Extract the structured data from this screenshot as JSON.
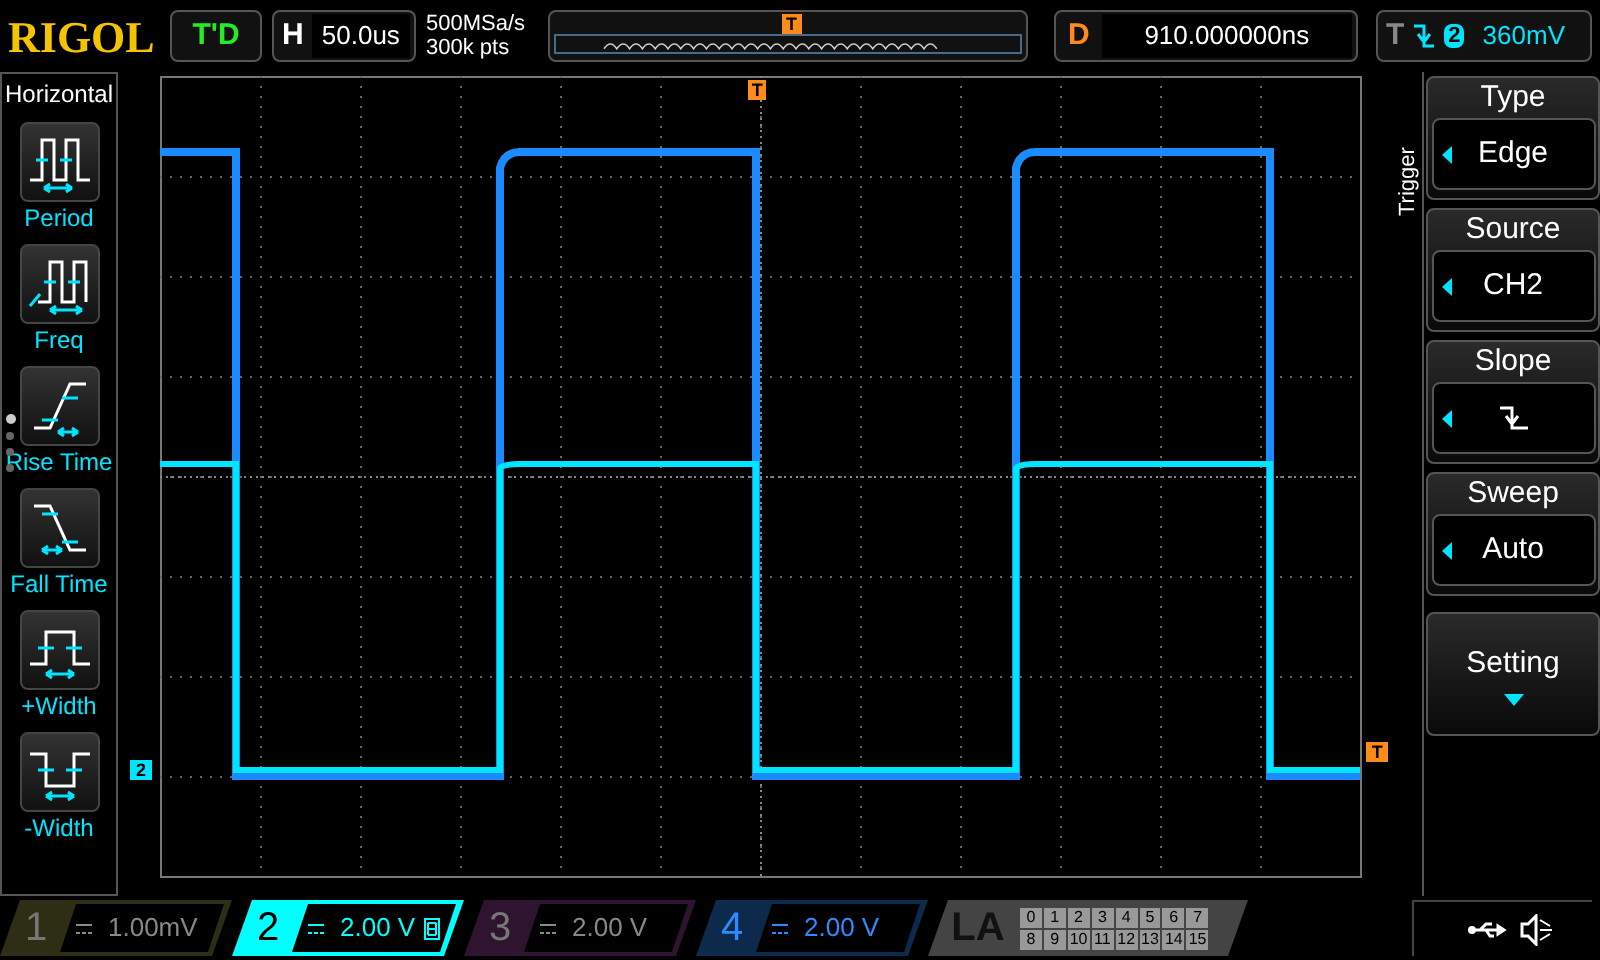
{
  "brand": "RIGOL",
  "run_status": "T'D",
  "timebase": {
    "label": "H",
    "value": "50.0us"
  },
  "acquisition": {
    "sample_rate": "500MSa/s",
    "memory_depth": "300k pts"
  },
  "delay": {
    "label": "D",
    "value": "910.000000ns"
  },
  "trigger_status": {
    "label": "T",
    "source": "2",
    "level": "360mV"
  },
  "trigger_position_marker": "T",
  "grid_trigger_marker": "T",
  "trigger_level_marker": "T",
  "channel_marker": "2",
  "measure_menu": {
    "title": "Horizontal",
    "items": [
      {
        "label": "Period",
        "kind": "period"
      },
      {
        "label": "Freq",
        "kind": "freq"
      },
      {
        "label": "Rise Time",
        "kind": "rise"
      },
      {
        "label": "Fall Time",
        "kind": "fall"
      },
      {
        "label": "+Width",
        "kind": "pwidth"
      },
      {
        "label": "-Width",
        "kind": "nwidth"
      }
    ],
    "pages": [
      {
        "selected": true
      },
      {
        "selected": false
      },
      {
        "selected": false
      },
      {
        "selected": false
      }
    ]
  },
  "trigger_menu": {
    "title": "Trigger",
    "items": [
      {
        "label": "Type",
        "value": "Edge",
        "kind": "value"
      },
      {
        "label": "Source",
        "value": "CH2",
        "kind": "value"
      },
      {
        "label": "Slope",
        "kind": "slope"
      },
      {
        "label": "Sweep",
        "value": "Auto",
        "kind": "value"
      },
      {
        "label": "Setting",
        "kind": "submenu"
      }
    ]
  },
  "channels": [
    {
      "number": "1",
      "scale": "1.00mV",
      "on": false,
      "selected": false,
      "bandwidth_limit": false,
      "color": "#2e2e14"
    },
    {
      "number": "2",
      "scale": "2.00 V",
      "on": true,
      "selected": true,
      "bandwidth_limit": true,
      "color": "#00ffff"
    },
    {
      "number": "3",
      "scale": "2.00 V",
      "on": false,
      "selected": false,
      "bandwidth_limit": false,
      "color": "#2e142e"
    },
    {
      "number": "4",
      "scale": "2.00 V",
      "on": true,
      "selected": false,
      "bandwidth_limit": false,
      "color": "#0d2a4d"
    }
  ],
  "logic_analyzer": {
    "label": "LA",
    "bits": [
      "0",
      "1",
      "2",
      "3",
      "4",
      "5",
      "6",
      "7",
      "8",
      "9",
      "10",
      "11",
      "12",
      "13",
      "14",
      "15"
    ]
  }
}
